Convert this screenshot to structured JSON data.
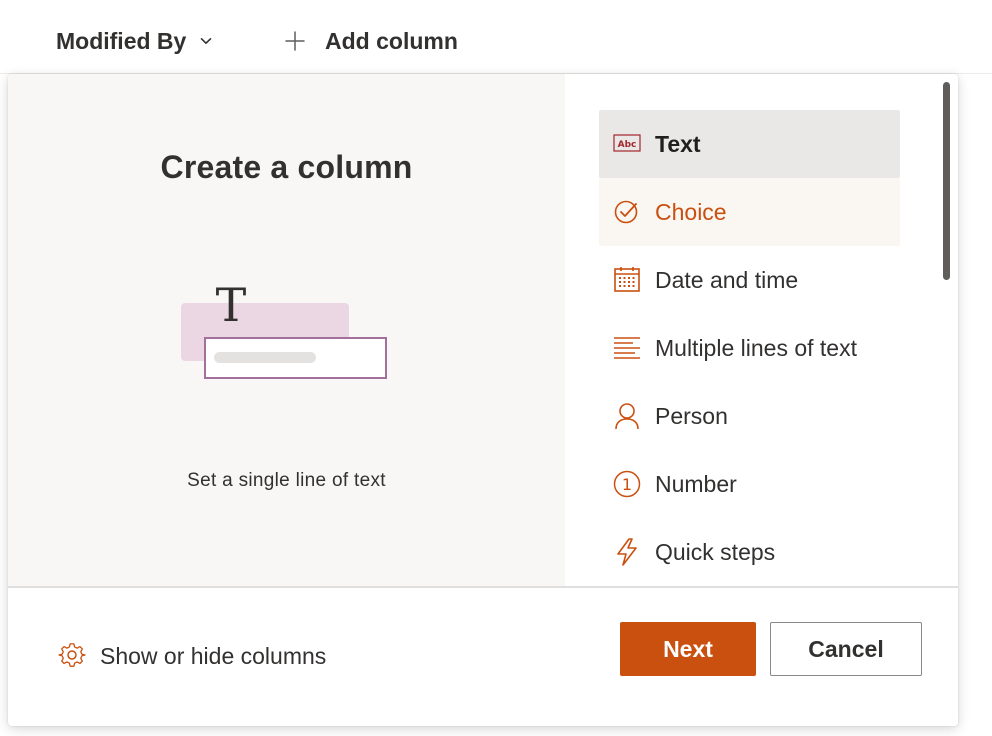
{
  "header": {
    "modified_by_label": "Modified By",
    "add_column_label": "Add column"
  },
  "panel": {
    "title": "Create a column",
    "caption": "Set a single line of text",
    "illustration_glyph": "T"
  },
  "types": [
    {
      "label": "Text",
      "icon": "text-abc-icon",
      "state": "selected"
    },
    {
      "label": "Choice",
      "icon": "choice-check-icon",
      "state": "hover"
    },
    {
      "label": "Date and time",
      "icon": "calendar-icon",
      "state": "normal"
    },
    {
      "label": "Multiple lines of text",
      "icon": "multiline-text-icon",
      "state": "normal"
    },
    {
      "label": "Person",
      "icon": "person-icon",
      "state": "normal"
    },
    {
      "label": "Number",
      "icon": "number-icon",
      "state": "normal"
    },
    {
      "label": "Quick steps",
      "icon": "lightning-icon",
      "state": "normal"
    }
  ],
  "text_icon_label": "Abc",
  "number_icon_label": "1",
  "footer": {
    "show_hide_label": "Show or hide columns",
    "next_label": "Next",
    "cancel_label": "Cancel"
  },
  "colors": {
    "accent": "#ca5010",
    "selected_bg": "#e9e8e6",
    "hover_bg": "#faf6f2",
    "illustration_pink": "#ead7e3",
    "illustration_border": "#a3709c"
  }
}
